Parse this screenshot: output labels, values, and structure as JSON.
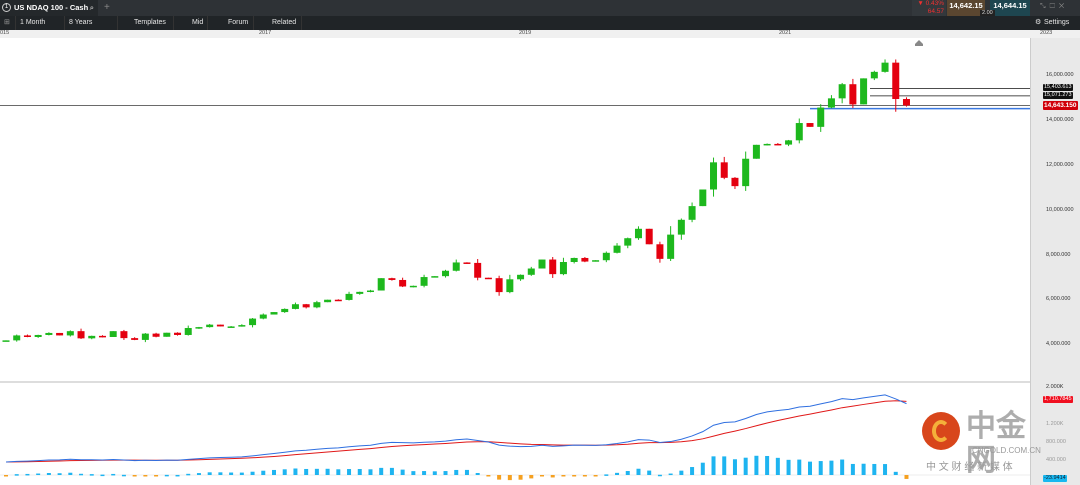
{
  "tab": {
    "number": "1",
    "title": "US NDAQ 100 - Cash",
    "add": "+"
  },
  "quote": {
    "change_pct": "▼ 0.43%",
    "change_abs": "64.57",
    "bid": "14,642.15",
    "ask": "14,644.15",
    "spread": "2.00"
  },
  "toolbar": {
    "interval": "1 Month",
    "range": "8 Years",
    "templates": "Templates",
    "mid": "Mid",
    "forum": "Forum",
    "related": "Related",
    "settings": "Settings"
  },
  "years": [
    "015",
    "2017",
    "2019",
    "2021",
    "2023"
  ],
  "price_axis": [
    "16,000.000",
    "14,000.000",
    "12,000.000",
    "10,000.000",
    "8,000.000",
    "6,000.000",
    "4,000.000"
  ],
  "tags": {
    "level1": "15,403.613",
    "level2": "15,071.273",
    "current": "14,643.150"
  },
  "indicator_axis": [
    "2.000K",
    "1.200K",
    "800.000",
    "400.000"
  ],
  "indicator_tags": {
    "signal": "1,710.7845",
    "hist": "-23.9414"
  },
  "watermark": {
    "brand": "中金网",
    "url": "CNGOLD.COM.CN",
    "tagline": "中 文 财 经 新 媒 体"
  },
  "colors": {
    "up": "#1db81d",
    "down": "#e4000f",
    "macd": "#2f6fe0",
    "signal": "#e01818",
    "hist_pos": "#1eb4f0",
    "hist_neg": "#f5a020"
  },
  "chart_data": {
    "type": "candlestick",
    "interval": "1 Month",
    "start_open": 4150,
    "closes": [
      4180,
      4400,
      4330,
      4420,
      4510,
      4400,
      4590,
      4270,
      4380,
      4330,
      4590,
      4280,
      4200,
      4480,
      4340,
      4520,
      4420,
      4730,
      4770,
      4880,
      4800,
      4800,
      4860,
      5150,
      5330,
      5440,
      5580,
      5790,
      5650,
      5880,
      5990,
      5980,
      6250,
      6340,
      6400,
      6950,
      6870,
      6580,
      6610,
      7000,
      7040,
      7280,
      7650,
      7630,
      6970,
      6950,
      6330,
      6900,
      7100,
      7380,
      7780,
      7130,
      7670,
      7850,
      7690,
      7750,
      8080,
      8400,
      8730,
      9150,
      8460,
      7810,
      8890,
      9550,
      10160,
      10900,
      12110,
      11420,
      11050,
      12270,
      12890,
      12930,
      12900,
      13090,
      13860,
      13690,
      14550,
      14960,
      15590,
      14690,
      15850,
      16140,
      16550,
      14930,
      14643
    ],
    "levels": [
      15403.613,
      15071.273,
      14643.15,
      14500
    ],
    "ylim": [
      3600,
      17000
    ]
  }
}
